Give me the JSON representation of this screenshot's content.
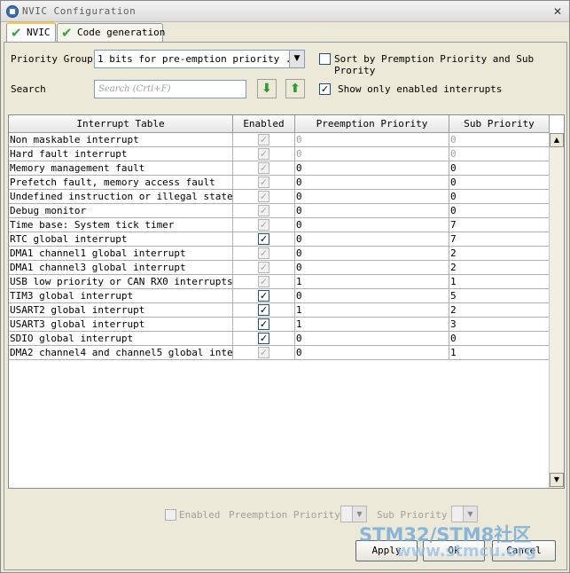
{
  "window": {
    "title": "NVIC Configuration",
    "close_glyph": "✕"
  },
  "tabs": [
    {
      "label": "NVIC",
      "active": true
    },
    {
      "label": "Code generation",
      "active": false
    }
  ],
  "priority_group": {
    "label": "Priority Group",
    "value": "1 bits for pre-emption priority ...",
    "arrow": "▼"
  },
  "sort_option": {
    "label": "Sort by Premption Priority and Sub Prority",
    "checked": false
  },
  "search": {
    "label": "Search",
    "placeholder": "Search (Crtl+F)",
    "down_glyph": "⬇",
    "up_glyph": "⬆"
  },
  "show_enabled": {
    "label": "Show only enabled interrupts",
    "checked": true,
    "glyph": "✓"
  },
  "table": {
    "headers": [
      "Interrupt Table",
      "Enabled",
      "Preemption Priority",
      "Sub Priority"
    ],
    "rows": [
      {
        "name": "Non maskable interrupt",
        "enabled": true,
        "locked": true,
        "pre": "0",
        "sub": "0",
        "gray": true
      },
      {
        "name": "Hard fault interrupt",
        "enabled": true,
        "locked": true,
        "pre": "0",
        "sub": "0",
        "gray": true
      },
      {
        "name": "Memory management fault",
        "enabled": true,
        "locked": true,
        "pre": "0",
        "sub": "0",
        "gray": false
      },
      {
        "name": "Prefetch fault, memory access fault",
        "enabled": true,
        "locked": true,
        "pre": "0",
        "sub": "0",
        "gray": false
      },
      {
        "name": "Undefined instruction or illegal state",
        "enabled": true,
        "locked": true,
        "pre": "0",
        "sub": "0",
        "gray": false
      },
      {
        "name": "Debug monitor",
        "enabled": true,
        "locked": true,
        "pre": "0",
        "sub": "0",
        "gray": false
      },
      {
        "name": "Time base: System tick timer",
        "enabled": true,
        "locked": true,
        "pre": "0",
        "sub": "7",
        "gray": false
      },
      {
        "name": "RTC global interrupt",
        "enabled": true,
        "locked": false,
        "pre": "0",
        "sub": "7",
        "gray": false
      },
      {
        "name": "DMA1 channel1 global interrupt",
        "enabled": true,
        "locked": true,
        "pre": "0",
        "sub": "2",
        "gray": false
      },
      {
        "name": "DMA1 channel3 global interrupt",
        "enabled": true,
        "locked": true,
        "pre": "0",
        "sub": "2",
        "gray": false
      },
      {
        "name": "USB low priority or CAN RX0 interrupts",
        "enabled": true,
        "locked": true,
        "pre": "1",
        "sub": "1",
        "gray": false
      },
      {
        "name": "TIM3 global interrupt",
        "enabled": true,
        "locked": false,
        "pre": "0",
        "sub": "5",
        "gray": false
      },
      {
        "name": "USART2 global interrupt",
        "enabled": true,
        "locked": false,
        "pre": "1",
        "sub": "2",
        "gray": false
      },
      {
        "name": "USART3 global interrupt",
        "enabled": true,
        "locked": false,
        "pre": "1",
        "sub": "3",
        "gray": false
      },
      {
        "name": "SDIO global interrupt",
        "enabled": true,
        "locked": false,
        "pre": "0",
        "sub": "0",
        "gray": false
      },
      {
        "name": "DMA2 channel4 and channel5 global inte...",
        "enabled": true,
        "locked": true,
        "pre": "0",
        "sub": "1",
        "gray": false
      }
    ],
    "check_glyph": "✓",
    "scroll_up_glyph": "▲",
    "scroll_down_glyph": "▼"
  },
  "footer": {
    "enabled_label": "Enabled",
    "preemption_label": "Preemption Priority",
    "sub_label": "Sub Priority",
    "arrow": "▼"
  },
  "buttons": {
    "apply": "Apply",
    "ok": "Ok",
    "cancel": "Cancel"
  },
  "watermark": {
    "line1": "STM32/STM8社区",
    "line2": "www.stmcu.org"
  },
  "colors": {
    "check_green": "#3aa33a",
    "tab_accent": "#ffc83c",
    "watermark": "#69a6d8"
  }
}
